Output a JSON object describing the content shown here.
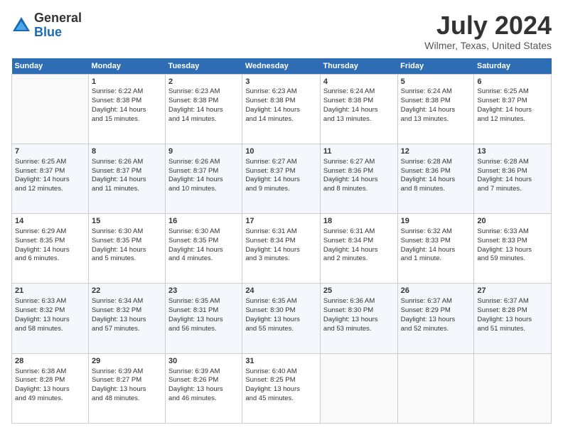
{
  "header": {
    "logo_general": "General",
    "logo_blue": "Blue",
    "month_year": "July 2024",
    "location": "Wilmer, Texas, United States"
  },
  "weekdays": [
    "Sunday",
    "Monday",
    "Tuesday",
    "Wednesday",
    "Thursday",
    "Friday",
    "Saturday"
  ],
  "weeks": [
    [
      {
        "day": "",
        "info": ""
      },
      {
        "day": "1",
        "info": "Sunrise: 6:22 AM\nSunset: 8:38 PM\nDaylight: 14 hours\nand 15 minutes."
      },
      {
        "day": "2",
        "info": "Sunrise: 6:23 AM\nSunset: 8:38 PM\nDaylight: 14 hours\nand 14 minutes."
      },
      {
        "day": "3",
        "info": "Sunrise: 6:23 AM\nSunset: 8:38 PM\nDaylight: 14 hours\nand 14 minutes."
      },
      {
        "day": "4",
        "info": "Sunrise: 6:24 AM\nSunset: 8:38 PM\nDaylight: 14 hours\nand 13 minutes."
      },
      {
        "day": "5",
        "info": "Sunrise: 6:24 AM\nSunset: 8:38 PM\nDaylight: 14 hours\nand 13 minutes."
      },
      {
        "day": "6",
        "info": "Sunrise: 6:25 AM\nSunset: 8:37 PM\nDaylight: 14 hours\nand 12 minutes."
      }
    ],
    [
      {
        "day": "7",
        "info": "Sunrise: 6:25 AM\nSunset: 8:37 PM\nDaylight: 14 hours\nand 12 minutes."
      },
      {
        "day": "8",
        "info": "Sunrise: 6:26 AM\nSunset: 8:37 PM\nDaylight: 14 hours\nand 11 minutes."
      },
      {
        "day": "9",
        "info": "Sunrise: 6:26 AM\nSunset: 8:37 PM\nDaylight: 14 hours\nand 10 minutes."
      },
      {
        "day": "10",
        "info": "Sunrise: 6:27 AM\nSunset: 8:37 PM\nDaylight: 14 hours\nand 9 minutes."
      },
      {
        "day": "11",
        "info": "Sunrise: 6:27 AM\nSunset: 8:36 PM\nDaylight: 14 hours\nand 8 minutes."
      },
      {
        "day": "12",
        "info": "Sunrise: 6:28 AM\nSunset: 8:36 PM\nDaylight: 14 hours\nand 8 minutes."
      },
      {
        "day": "13",
        "info": "Sunrise: 6:28 AM\nSunset: 8:36 PM\nDaylight: 14 hours\nand 7 minutes."
      }
    ],
    [
      {
        "day": "14",
        "info": "Sunrise: 6:29 AM\nSunset: 8:35 PM\nDaylight: 14 hours\nand 6 minutes."
      },
      {
        "day": "15",
        "info": "Sunrise: 6:30 AM\nSunset: 8:35 PM\nDaylight: 14 hours\nand 5 minutes."
      },
      {
        "day": "16",
        "info": "Sunrise: 6:30 AM\nSunset: 8:35 PM\nDaylight: 14 hours\nand 4 minutes."
      },
      {
        "day": "17",
        "info": "Sunrise: 6:31 AM\nSunset: 8:34 PM\nDaylight: 14 hours\nand 3 minutes."
      },
      {
        "day": "18",
        "info": "Sunrise: 6:31 AM\nSunset: 8:34 PM\nDaylight: 14 hours\nand 2 minutes."
      },
      {
        "day": "19",
        "info": "Sunrise: 6:32 AM\nSunset: 8:33 PM\nDaylight: 14 hours\nand 1 minute."
      },
      {
        "day": "20",
        "info": "Sunrise: 6:33 AM\nSunset: 8:33 PM\nDaylight: 13 hours\nand 59 minutes."
      }
    ],
    [
      {
        "day": "21",
        "info": "Sunrise: 6:33 AM\nSunset: 8:32 PM\nDaylight: 13 hours\nand 58 minutes."
      },
      {
        "day": "22",
        "info": "Sunrise: 6:34 AM\nSunset: 8:32 PM\nDaylight: 13 hours\nand 57 minutes."
      },
      {
        "day": "23",
        "info": "Sunrise: 6:35 AM\nSunset: 8:31 PM\nDaylight: 13 hours\nand 56 minutes."
      },
      {
        "day": "24",
        "info": "Sunrise: 6:35 AM\nSunset: 8:30 PM\nDaylight: 13 hours\nand 55 minutes."
      },
      {
        "day": "25",
        "info": "Sunrise: 6:36 AM\nSunset: 8:30 PM\nDaylight: 13 hours\nand 53 minutes."
      },
      {
        "day": "26",
        "info": "Sunrise: 6:37 AM\nSunset: 8:29 PM\nDaylight: 13 hours\nand 52 minutes."
      },
      {
        "day": "27",
        "info": "Sunrise: 6:37 AM\nSunset: 8:28 PM\nDaylight: 13 hours\nand 51 minutes."
      }
    ],
    [
      {
        "day": "28",
        "info": "Sunrise: 6:38 AM\nSunset: 8:28 PM\nDaylight: 13 hours\nand 49 minutes."
      },
      {
        "day": "29",
        "info": "Sunrise: 6:39 AM\nSunset: 8:27 PM\nDaylight: 13 hours\nand 48 minutes."
      },
      {
        "day": "30",
        "info": "Sunrise: 6:39 AM\nSunset: 8:26 PM\nDaylight: 13 hours\nand 46 minutes."
      },
      {
        "day": "31",
        "info": "Sunrise: 6:40 AM\nSunset: 8:25 PM\nDaylight: 13 hours\nand 45 minutes."
      },
      {
        "day": "",
        "info": ""
      },
      {
        "day": "",
        "info": ""
      },
      {
        "day": "",
        "info": ""
      }
    ]
  ]
}
